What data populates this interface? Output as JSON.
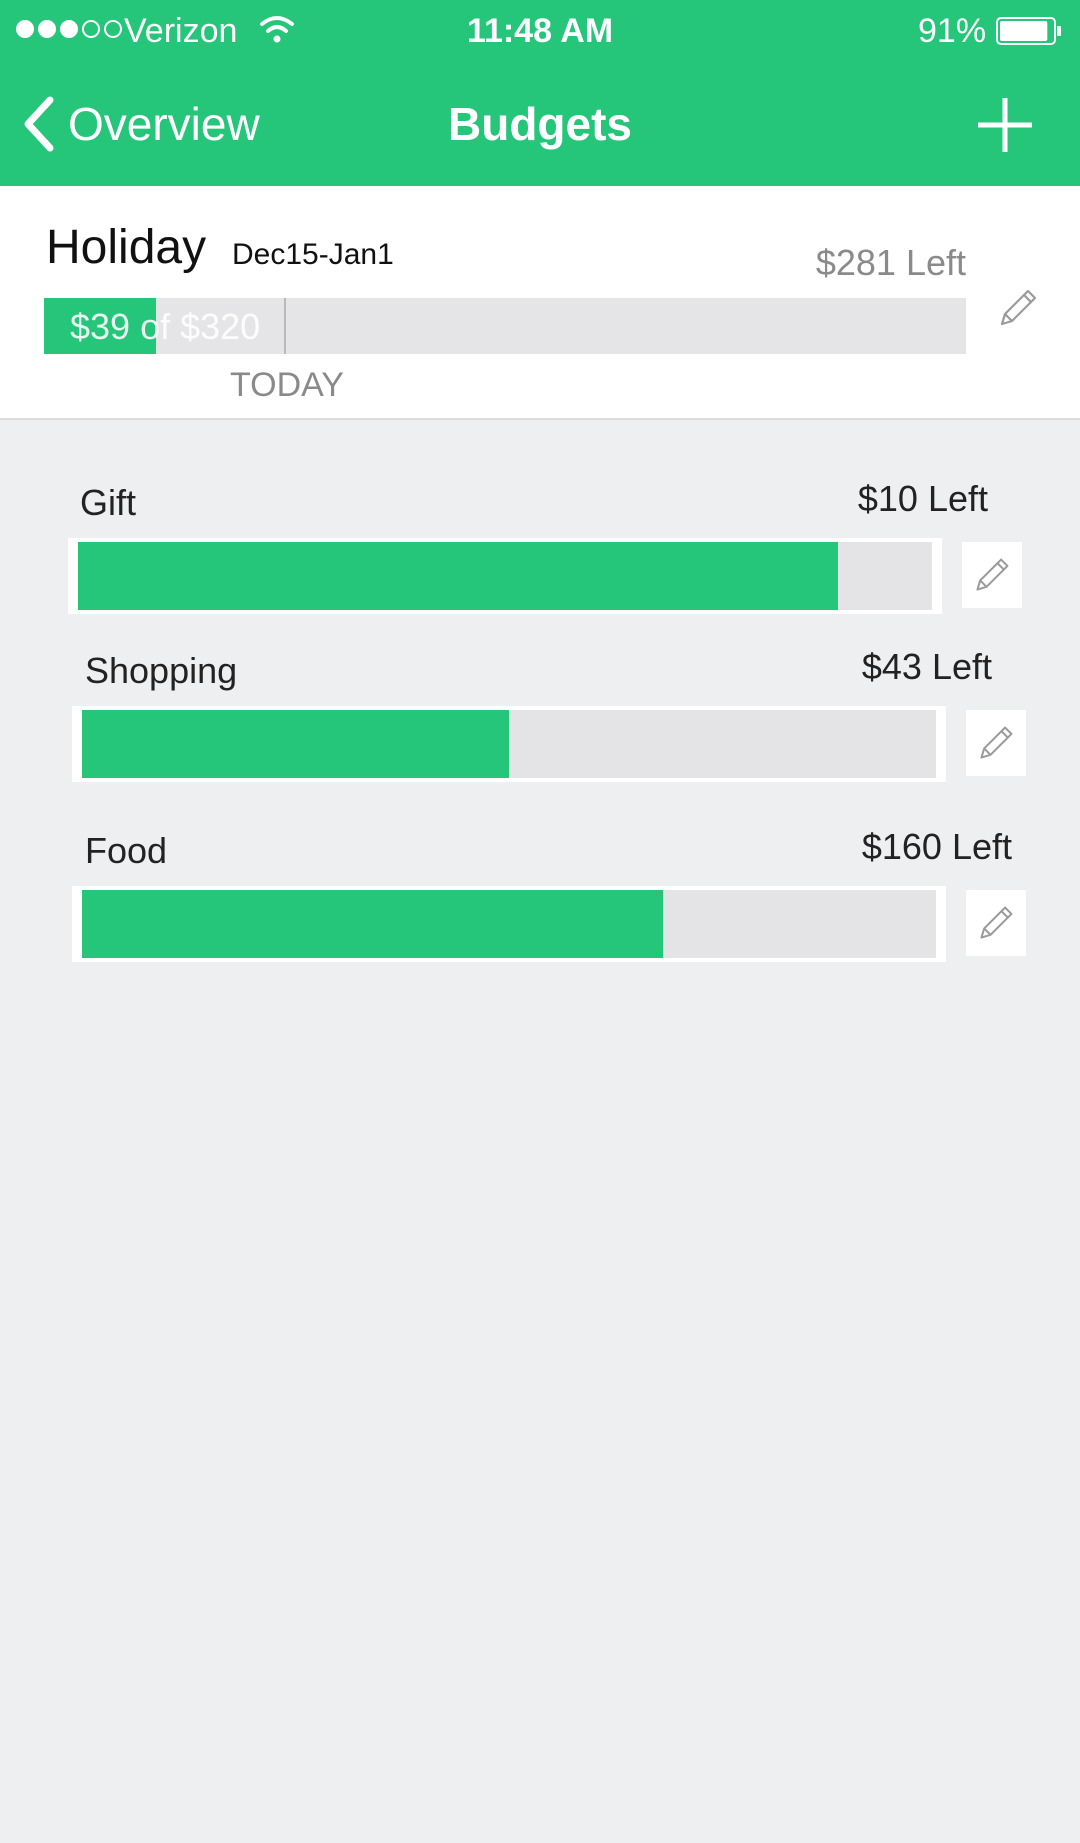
{
  "status_bar": {
    "carrier": "Verizon",
    "time": "11:48 AM",
    "battery": "91%",
    "signal_strength": 3,
    "signal_max": 5,
    "battery_level": 0.91
  },
  "nav": {
    "back_label": "Overview",
    "title": "Budgets",
    "add_icon": "plus-icon"
  },
  "summary": {
    "title": "Holiday",
    "dates": "Dec15-Jan1",
    "left": "$281 Left",
    "amount": "$39 of $320",
    "spent_fraction": 0.122,
    "today_fraction": 0.26,
    "today_label": "TODAY"
  },
  "categories": [
    {
      "name": "Gift",
      "left": "$10 Left",
      "fraction": 0.89
    },
    {
      "name": "Shopping",
      "left": "$43 Left",
      "fraction": 0.5
    },
    {
      "name": "Food",
      "left": "$160 Left",
      "fraction": 0.68
    }
  ],
  "colors": {
    "accent": "#25c57a",
    "track": "#e4e4e6",
    "background": "#eeeff1"
  }
}
